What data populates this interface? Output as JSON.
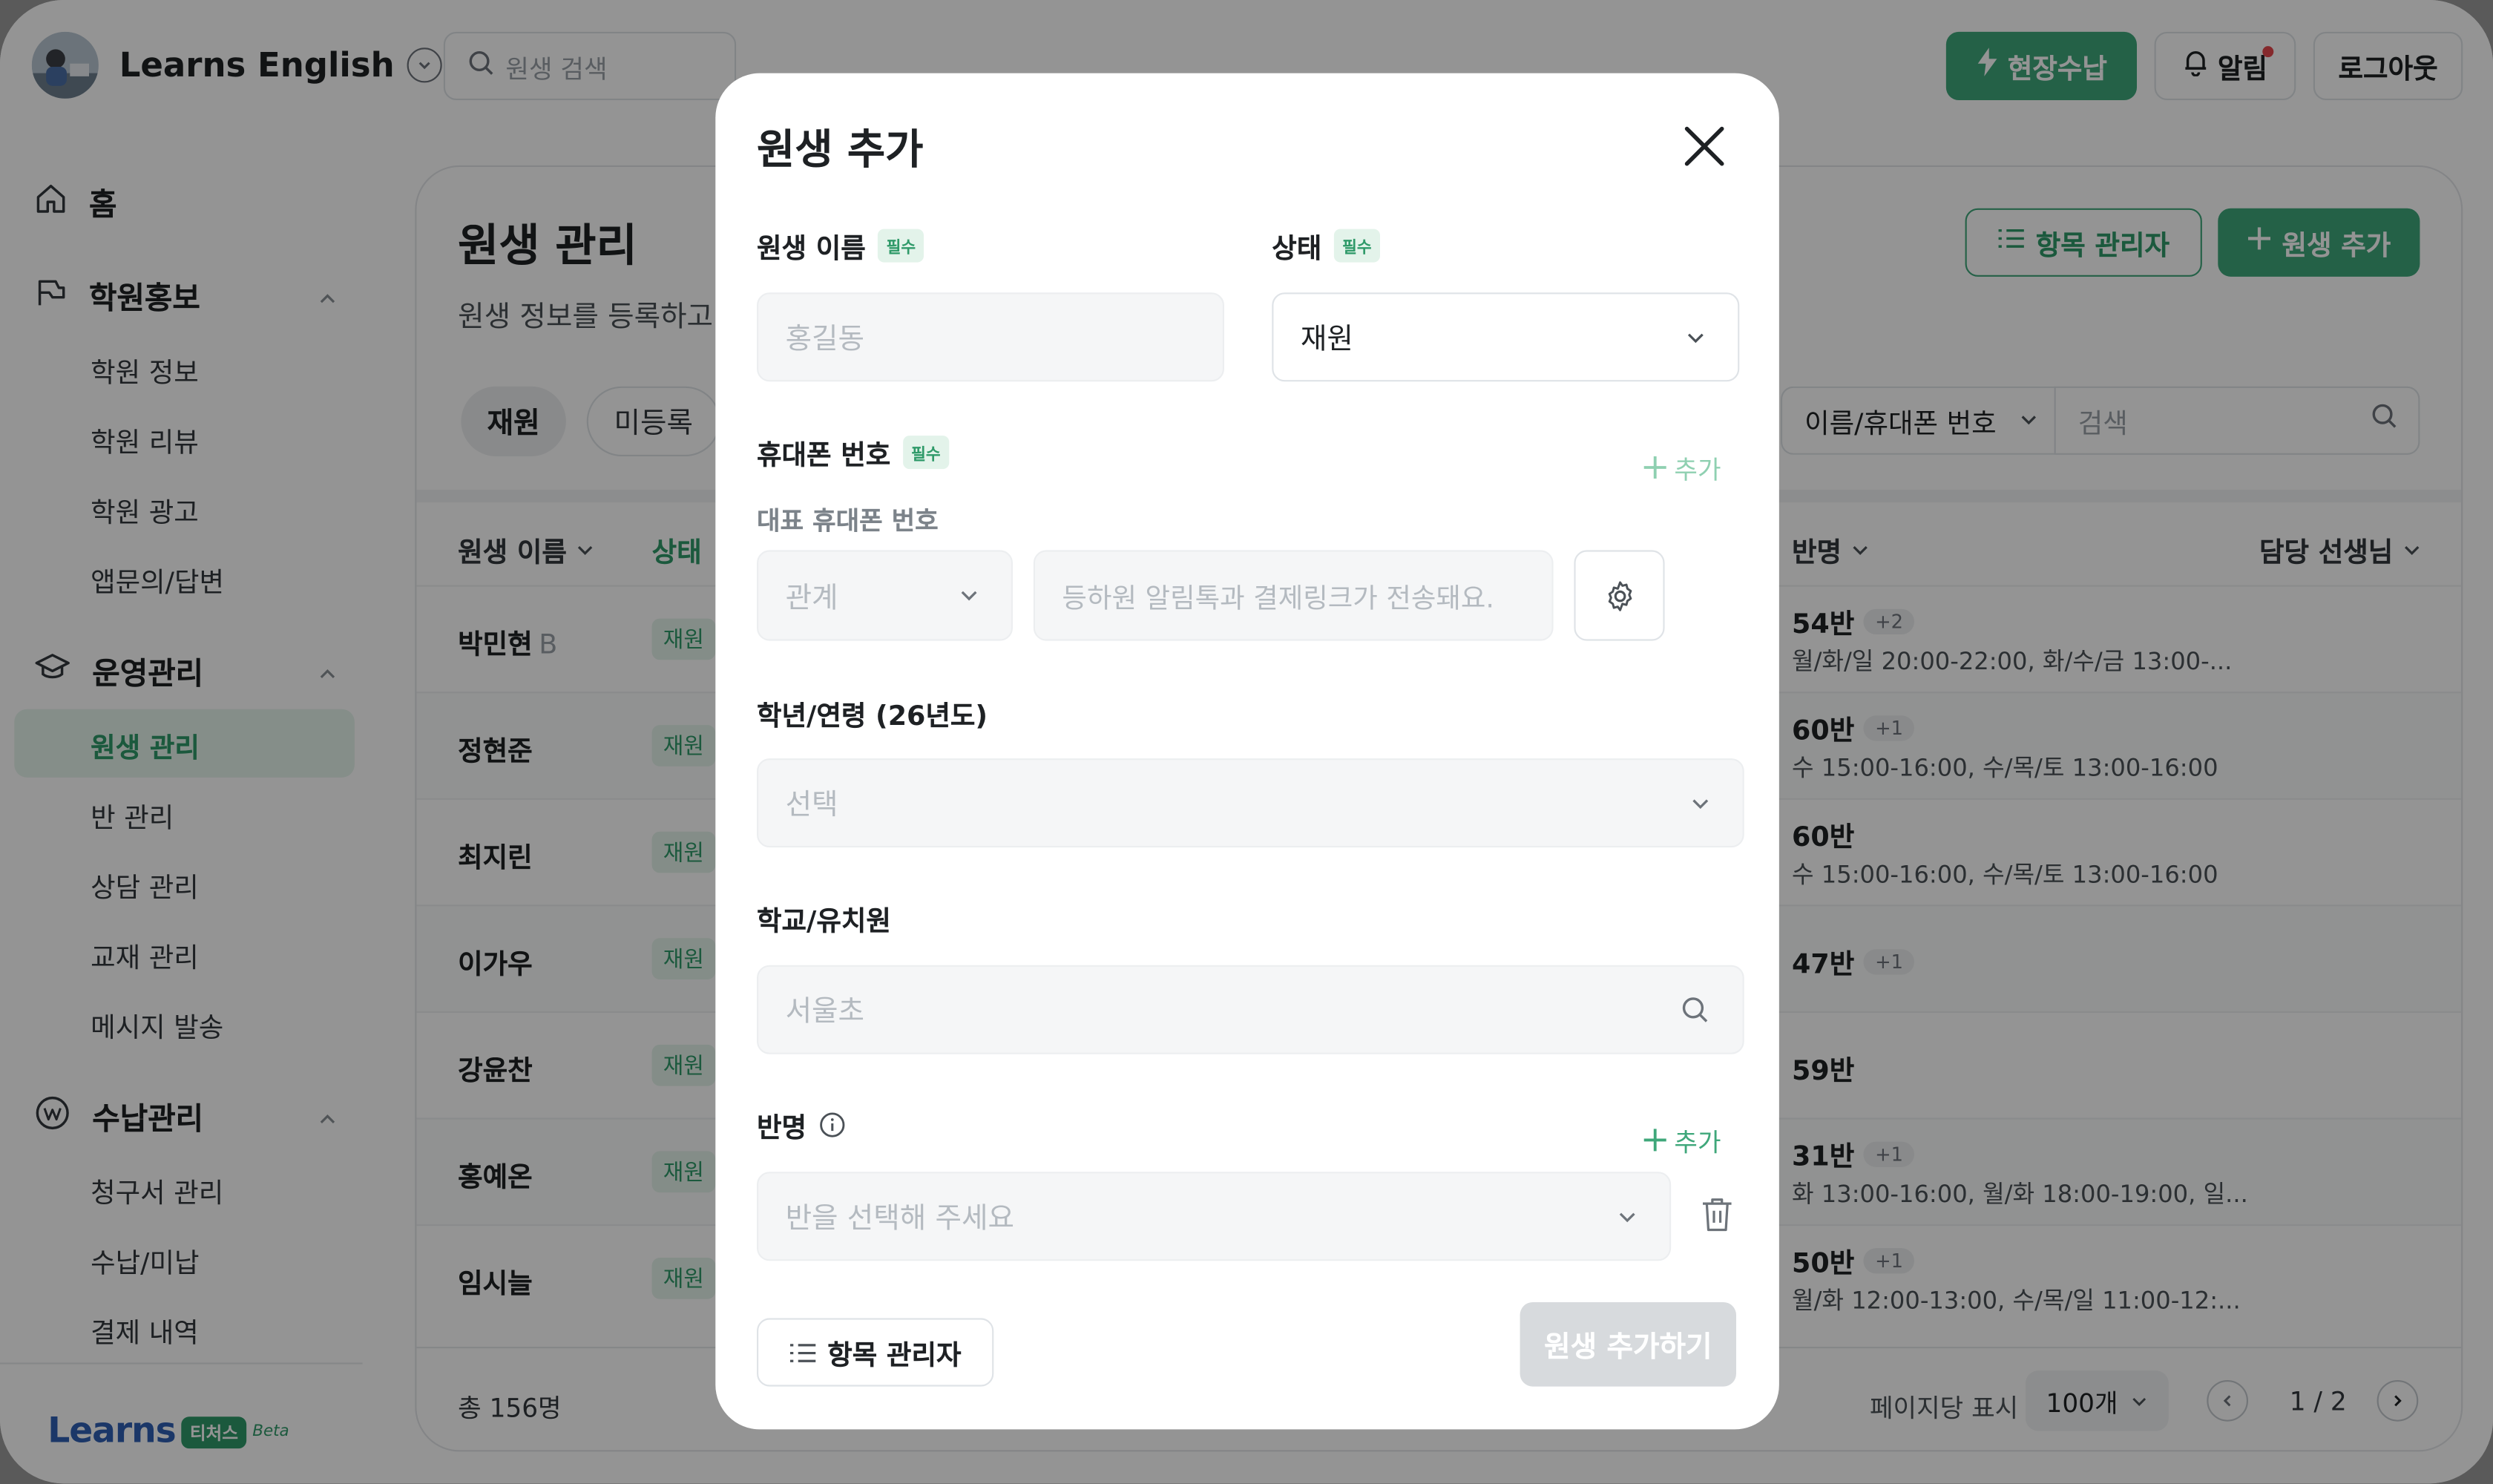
{
  "topbar": {
    "brand_name": "Learns English",
    "search_placeholder": "원생 검색",
    "onsite_payment_label": "현장수납",
    "alarm_label": "알림",
    "logout_label": "로그아웃"
  },
  "sidebar": {
    "home": "홈",
    "groups": [
      {
        "label": "학원홍보",
        "items": [
          "학원 정보",
          "학원 리뷰",
          "학원 광고",
          "앱문의/답변"
        ]
      },
      {
        "label": "운영관리",
        "items": [
          "원생 관리",
          "반 관리",
          "상담 관리",
          "교재 관리",
          "메시지 발송"
        ]
      },
      {
        "label": "수납관리",
        "items": [
          "청구서 관리",
          "수납/미납",
          "결제 내역"
        ]
      }
    ],
    "active_item": "원생 관리",
    "logo": {
      "word": "Learns",
      "badge": "티처스",
      "beta": "Beta"
    }
  },
  "main": {
    "title": "원생 관리",
    "description": "원생 정보를 등록하고",
    "item_manager_label": "항목 관리자",
    "add_student_label": "원생 추가",
    "chips": [
      "재원",
      "미등록"
    ],
    "filter_select": "이름/휴대폰 번호",
    "filter_search_placeholder": "검색",
    "columns": {
      "name": "원생 이름",
      "status": "상태",
      "class": "반명",
      "teacher": "담당 선생님"
    },
    "rows": [
      {
        "name": "박민현",
        "suffix": "B",
        "status": "재원",
        "class": "54반",
        "extra": "+2",
        "schedule": "월/화/일 20:00-22:00, 화/수/금 13:00-..."
      },
      {
        "name": "정현준",
        "suffix": "",
        "status": "재원",
        "class": "60반",
        "extra": "+1",
        "schedule": "수 15:00-16:00, 수/목/토 13:00-16:00"
      },
      {
        "name": "최지린",
        "suffix": "",
        "status": "재원",
        "class": "60반",
        "extra": "",
        "schedule": "수 15:00-16:00, 수/목/토 13:00-16:00"
      },
      {
        "name": "이가우",
        "suffix": "",
        "status": "재원",
        "class": "47반",
        "extra": "+1",
        "schedule": ""
      },
      {
        "name": "강윤찬",
        "suffix": "",
        "status": "재원",
        "class": "59반",
        "extra": "",
        "schedule": ""
      },
      {
        "name": "홍예온",
        "suffix": "",
        "status": "재원",
        "class": "31반",
        "extra": "+1",
        "schedule": "화 13:00-16:00, 월/화 18:00-19:00, 일..."
      },
      {
        "name": "임시늘",
        "suffix": "",
        "status": "재원",
        "class": "50반",
        "extra": "+1",
        "schedule": "월/화 12:00-13:00, 수/목/일 11:00-12:..."
      }
    ],
    "footer": {
      "total": "총 156명",
      "per_page_label": "페이지당 표시",
      "per_page_value": "100개",
      "page": "1 / 2"
    }
  },
  "modal": {
    "title": "원생 추가",
    "name_label": "원생 이름",
    "required_badge": "필수",
    "name_placeholder": "홍길동",
    "status_label": "상태",
    "status_value": "재원",
    "phone_label": "휴대폰 번호",
    "phone_add_label": "추가",
    "phone_sublabel": "대표 휴대폰 번호",
    "relation_placeholder": "관계",
    "phone_placeholder": "등하원 알림톡과 결제링크가 전송돼요.",
    "grade_label": "학년/연령 (26년도)",
    "grade_placeholder": "선택",
    "school_label": "학교/유치원",
    "school_placeholder": "서울초",
    "class_label": "반명",
    "class_add_label": "추가",
    "class_placeholder": "반을 선택해 주세요",
    "item_manager_label": "항목 관리자",
    "submit_label": "원생 추가하기"
  }
}
